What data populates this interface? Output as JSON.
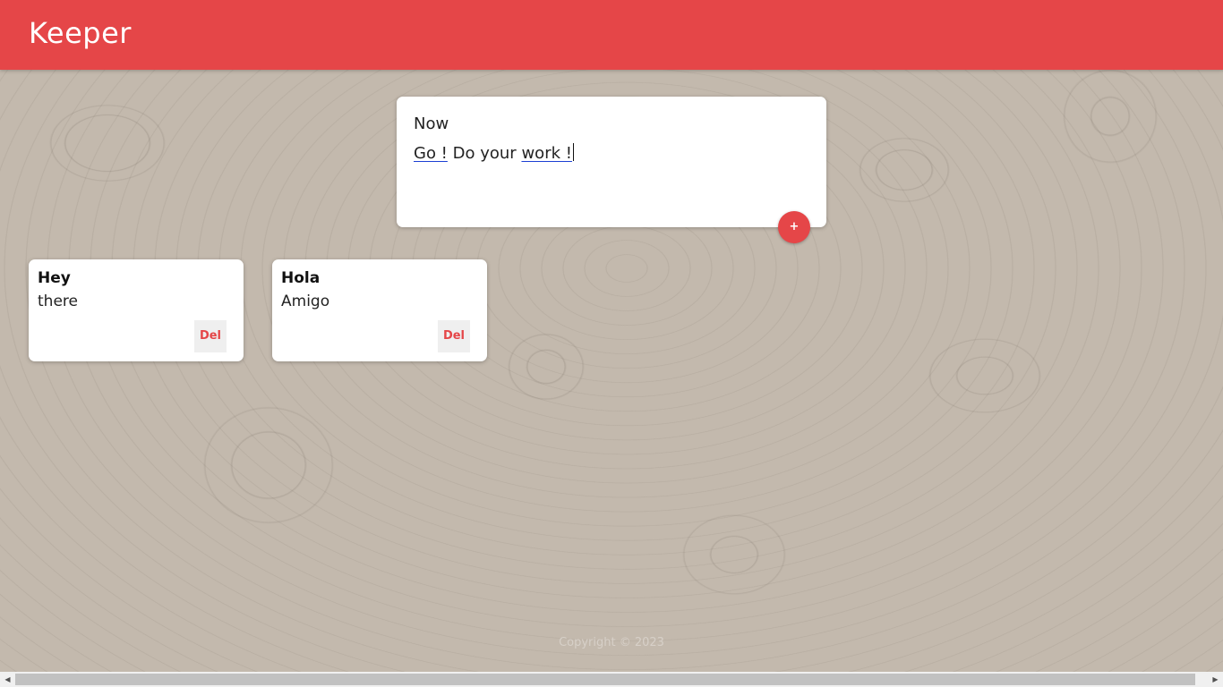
{
  "header": {
    "app_title": "Keeper",
    "background_color": "#e54648"
  },
  "composer": {
    "title_value": "Now",
    "content_words": [
      "Go !",
      "Do your",
      "work !"
    ],
    "add_button_label": "+"
  },
  "notes": [
    {
      "title": "Hey",
      "content": "there",
      "delete_label": "Del"
    },
    {
      "title": "Hola",
      "content": "Amigo",
      "delete_label": "Del"
    }
  ],
  "footer": {
    "copyright": "Copyright © 2023"
  },
  "scrollbar": {
    "left_arrow_icon": "◀",
    "right_arrow_icon": "▶"
  }
}
